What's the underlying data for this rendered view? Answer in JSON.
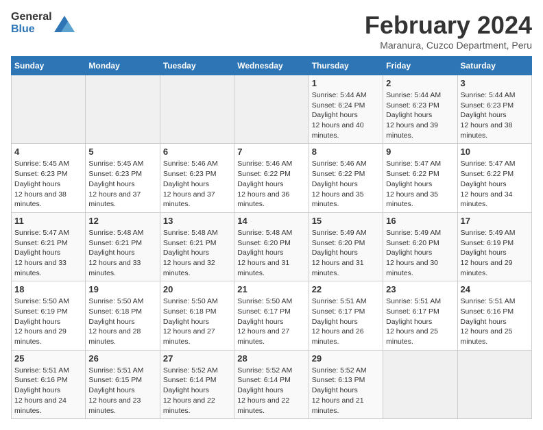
{
  "header": {
    "logo_general": "General",
    "logo_blue": "Blue",
    "main_title": "February 2024",
    "subtitle": "Maranura, Cuzco Department, Peru"
  },
  "calendar": {
    "days_of_week": [
      "Sunday",
      "Monday",
      "Tuesday",
      "Wednesday",
      "Thursday",
      "Friday",
      "Saturday"
    ],
    "weeks": [
      [
        {
          "day": "",
          "sunrise": "",
          "sunset": "",
          "daylight": "",
          "empty": true
        },
        {
          "day": "",
          "sunrise": "",
          "sunset": "",
          "daylight": "",
          "empty": true
        },
        {
          "day": "",
          "sunrise": "",
          "sunset": "",
          "daylight": "",
          "empty": true
        },
        {
          "day": "",
          "sunrise": "",
          "sunset": "",
          "daylight": "",
          "empty": true
        },
        {
          "day": "1",
          "sunrise": "5:44 AM",
          "sunset": "6:24 PM",
          "daylight": "12 hours and 40 minutes.",
          "empty": false
        },
        {
          "day": "2",
          "sunrise": "5:44 AM",
          "sunset": "6:23 PM",
          "daylight": "12 hours and 39 minutes.",
          "empty": false
        },
        {
          "day": "3",
          "sunrise": "5:44 AM",
          "sunset": "6:23 PM",
          "daylight": "12 hours and 38 minutes.",
          "empty": false
        }
      ],
      [
        {
          "day": "4",
          "sunrise": "5:45 AM",
          "sunset": "6:23 PM",
          "daylight": "12 hours and 38 minutes.",
          "empty": false
        },
        {
          "day": "5",
          "sunrise": "5:45 AM",
          "sunset": "6:23 PM",
          "daylight": "12 hours and 37 minutes.",
          "empty": false
        },
        {
          "day": "6",
          "sunrise": "5:46 AM",
          "sunset": "6:23 PM",
          "daylight": "12 hours and 37 minutes.",
          "empty": false
        },
        {
          "day": "7",
          "sunrise": "5:46 AM",
          "sunset": "6:22 PM",
          "daylight": "12 hours and 36 minutes.",
          "empty": false
        },
        {
          "day": "8",
          "sunrise": "5:46 AM",
          "sunset": "6:22 PM",
          "daylight": "12 hours and 35 minutes.",
          "empty": false
        },
        {
          "day": "9",
          "sunrise": "5:47 AM",
          "sunset": "6:22 PM",
          "daylight": "12 hours and 35 minutes.",
          "empty": false
        },
        {
          "day": "10",
          "sunrise": "5:47 AM",
          "sunset": "6:22 PM",
          "daylight": "12 hours and 34 minutes.",
          "empty": false
        }
      ],
      [
        {
          "day": "11",
          "sunrise": "5:47 AM",
          "sunset": "6:21 PM",
          "daylight": "12 hours and 33 minutes.",
          "empty": false
        },
        {
          "day": "12",
          "sunrise": "5:48 AM",
          "sunset": "6:21 PM",
          "daylight": "12 hours and 33 minutes.",
          "empty": false
        },
        {
          "day": "13",
          "sunrise": "5:48 AM",
          "sunset": "6:21 PM",
          "daylight": "12 hours and 32 minutes.",
          "empty": false
        },
        {
          "day": "14",
          "sunrise": "5:48 AM",
          "sunset": "6:20 PM",
          "daylight": "12 hours and 31 minutes.",
          "empty": false
        },
        {
          "day": "15",
          "sunrise": "5:49 AM",
          "sunset": "6:20 PM",
          "daylight": "12 hours and 31 minutes.",
          "empty": false
        },
        {
          "day": "16",
          "sunrise": "5:49 AM",
          "sunset": "6:20 PM",
          "daylight": "12 hours and 30 minutes.",
          "empty": false
        },
        {
          "day": "17",
          "sunrise": "5:49 AM",
          "sunset": "6:19 PM",
          "daylight": "12 hours and 29 minutes.",
          "empty": false
        }
      ],
      [
        {
          "day": "18",
          "sunrise": "5:50 AM",
          "sunset": "6:19 PM",
          "daylight": "12 hours and 29 minutes.",
          "empty": false
        },
        {
          "day": "19",
          "sunrise": "5:50 AM",
          "sunset": "6:18 PM",
          "daylight": "12 hours and 28 minutes.",
          "empty": false
        },
        {
          "day": "20",
          "sunrise": "5:50 AM",
          "sunset": "6:18 PM",
          "daylight": "12 hours and 27 minutes.",
          "empty": false
        },
        {
          "day": "21",
          "sunrise": "5:50 AM",
          "sunset": "6:17 PM",
          "daylight": "12 hours and 27 minutes.",
          "empty": false
        },
        {
          "day": "22",
          "sunrise": "5:51 AM",
          "sunset": "6:17 PM",
          "daylight": "12 hours and 26 minutes.",
          "empty": false
        },
        {
          "day": "23",
          "sunrise": "5:51 AM",
          "sunset": "6:17 PM",
          "daylight": "12 hours and 25 minutes.",
          "empty": false
        },
        {
          "day": "24",
          "sunrise": "5:51 AM",
          "sunset": "6:16 PM",
          "daylight": "12 hours and 25 minutes.",
          "empty": false
        }
      ],
      [
        {
          "day": "25",
          "sunrise": "5:51 AM",
          "sunset": "6:16 PM",
          "daylight": "12 hours and 24 minutes.",
          "empty": false
        },
        {
          "day": "26",
          "sunrise": "5:51 AM",
          "sunset": "6:15 PM",
          "daylight": "12 hours and 23 minutes.",
          "empty": false
        },
        {
          "day": "27",
          "sunrise": "5:52 AM",
          "sunset": "6:14 PM",
          "daylight": "12 hours and 22 minutes.",
          "empty": false
        },
        {
          "day": "28",
          "sunrise": "5:52 AM",
          "sunset": "6:14 PM",
          "daylight": "12 hours and 22 minutes.",
          "empty": false
        },
        {
          "day": "29",
          "sunrise": "5:52 AM",
          "sunset": "6:13 PM",
          "daylight": "12 hours and 21 minutes.",
          "empty": false
        },
        {
          "day": "",
          "sunrise": "",
          "sunset": "",
          "daylight": "",
          "empty": true
        },
        {
          "day": "",
          "sunrise": "",
          "sunset": "",
          "daylight": "",
          "empty": true
        }
      ]
    ],
    "labels": {
      "sunrise": "Sunrise:",
      "sunset": "Sunset:",
      "daylight": "Daylight:"
    }
  }
}
